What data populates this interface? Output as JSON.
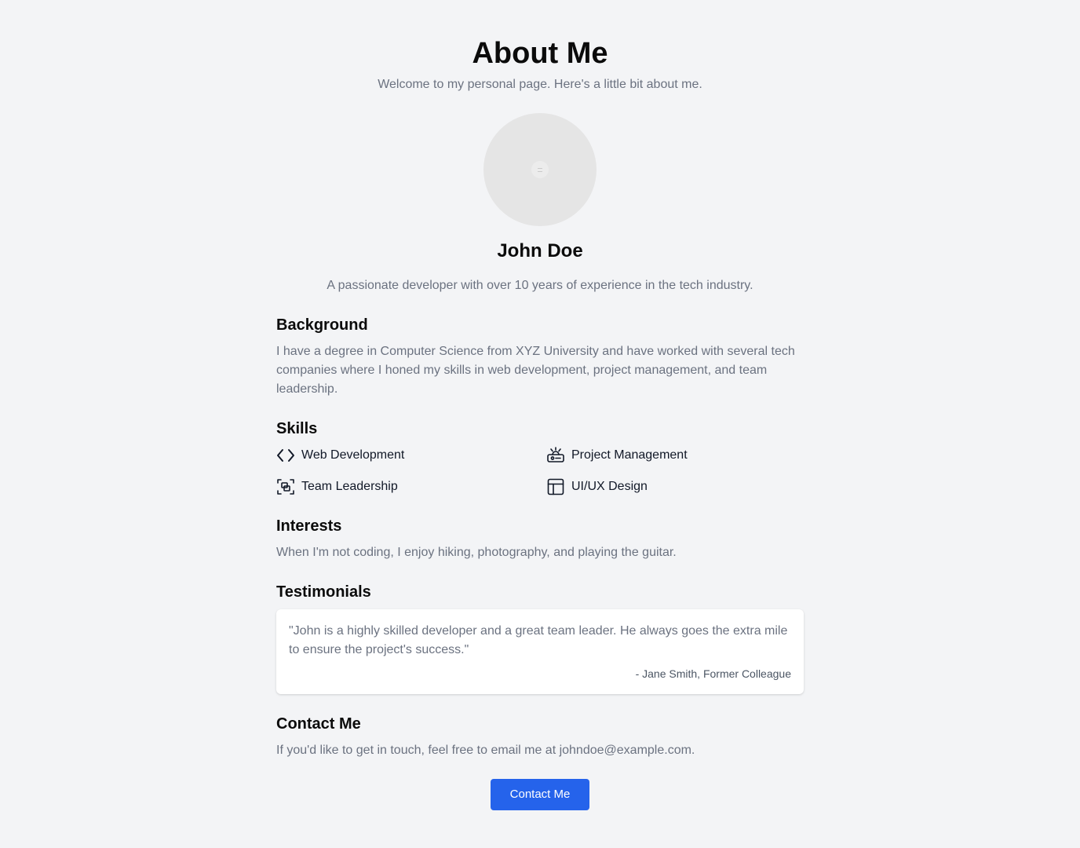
{
  "header": {
    "title": "About Me",
    "subtitle": "Welcome to my personal page. Here's a little bit about me."
  },
  "profile": {
    "name": "John Doe",
    "tagline": "A passionate developer with over 10 years of experience in the tech industry."
  },
  "background": {
    "heading": "Background",
    "text": "I have a degree in Computer Science from XYZ University and have worked with several tech companies where I honed my skills in web development, project management, and team leadership."
  },
  "skills": {
    "heading": "Skills",
    "items": [
      {
        "label": "Web Development",
        "icon": "code-icon"
      },
      {
        "label": "Project Management",
        "icon": "project-management-icon"
      },
      {
        "label": "Team Leadership",
        "icon": "team-leadership-icon"
      },
      {
        "label": "UI/UX Design",
        "icon": "layout-icon"
      }
    ]
  },
  "interests": {
    "heading": "Interests",
    "text": "When I'm not coding, I enjoy hiking, photography, and playing the guitar."
  },
  "testimonials": {
    "heading": "Testimonials",
    "items": [
      {
        "quote": "\"John is a highly skilled developer and a great team leader. He always goes the extra mile to ensure the project's success.\"",
        "author": "- Jane Smith, Former Colleague"
      }
    ]
  },
  "contact": {
    "heading": "Contact Me",
    "text": "If you'd like to get in touch, feel free to email me at johndoe@example.com.",
    "button_label": "Contact Me",
    "button_color": "#2563eb"
  }
}
